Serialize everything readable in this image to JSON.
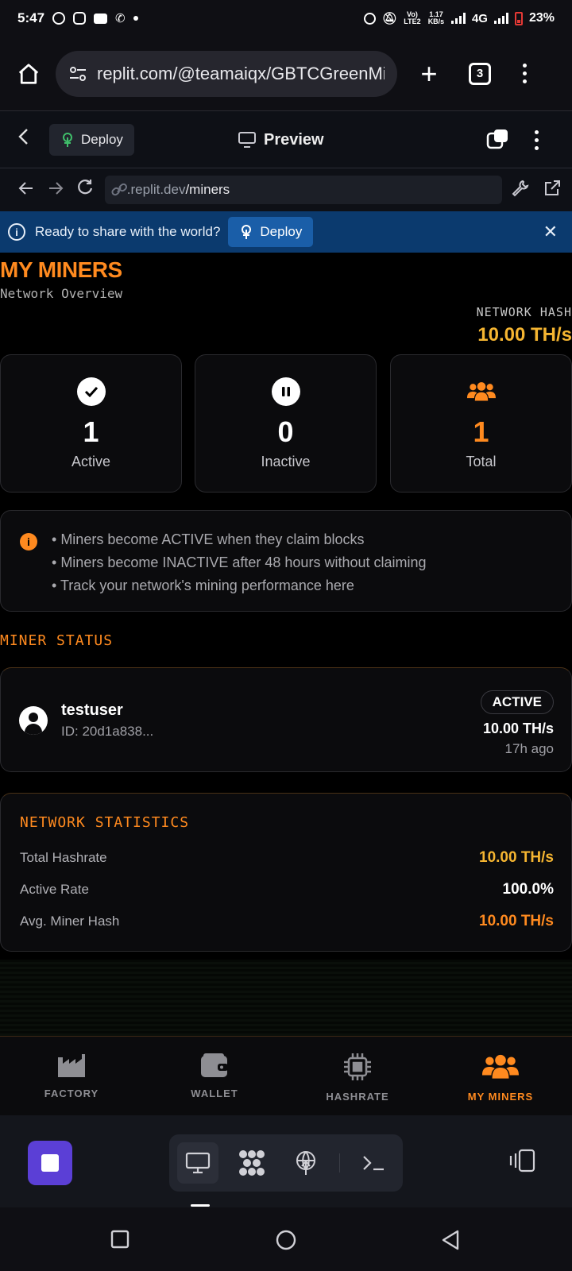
{
  "status_bar": {
    "time": "5:47",
    "lte": "Vo) LTE2",
    "speed": "1.17",
    "speed_unit": "KB/s",
    "network": "4G",
    "battery": "23%"
  },
  "browser": {
    "url": "replit.com/@teamaiqx/GBTCGreenMi",
    "tab_count": "3"
  },
  "replit_header": {
    "deploy_label": "Deploy",
    "title": "Preview"
  },
  "address_bar": {
    "domain": ".replit.dev",
    "path": "/miners"
  },
  "banner": {
    "message": "Ready to share with the world?",
    "button_label": "Deploy"
  },
  "page": {
    "title": "MY MINERS",
    "subtitle": "Network Overview",
    "network_hash_label": "NETWORK HASH",
    "network_hash_value": "10.00 TH/s"
  },
  "stats": [
    {
      "value": "1",
      "label": "Active",
      "icon": "check-circle-icon"
    },
    {
      "value": "0",
      "label": "Inactive",
      "icon": "pause-circle-icon"
    },
    {
      "value": "1",
      "label": "Total",
      "icon": "users-icon"
    }
  ],
  "info": {
    "items": [
      "Miners become ACTIVE when they claim blocks",
      "Miners become INACTIVE after 48 hours without claiming",
      "Track your network's mining performance here"
    ]
  },
  "miner_status": {
    "heading": "MINER STATUS",
    "miners": [
      {
        "name": "testuser",
        "id": "ID: 20d1a838...",
        "status": "ACTIVE",
        "hashrate": "10.00 TH/s",
        "last_seen": "17h ago"
      }
    ]
  },
  "network_statistics": {
    "heading": "NETWORK STATISTICS",
    "rows": [
      {
        "label": "Total Hashrate",
        "value": "10.00 TH/s"
      },
      {
        "label": "Active Rate",
        "value": "100.0%"
      },
      {
        "label": "Avg. Miner Hash",
        "value": "10.00 TH/s"
      }
    ]
  },
  "bottom_nav": [
    {
      "label": "FACTORY",
      "icon": "factory-icon"
    },
    {
      "label": "WALLET",
      "icon": "wallet-icon"
    },
    {
      "label": "HASHRATE",
      "icon": "cpu-icon"
    },
    {
      "label": "MY MINERS",
      "icon": "users-icon",
      "active": true
    }
  ],
  "colors": {
    "accent": "#ff8a1f",
    "gold": "#f5b531",
    "banner": "#0b3a6e",
    "stop": "#5b3fd6"
  }
}
